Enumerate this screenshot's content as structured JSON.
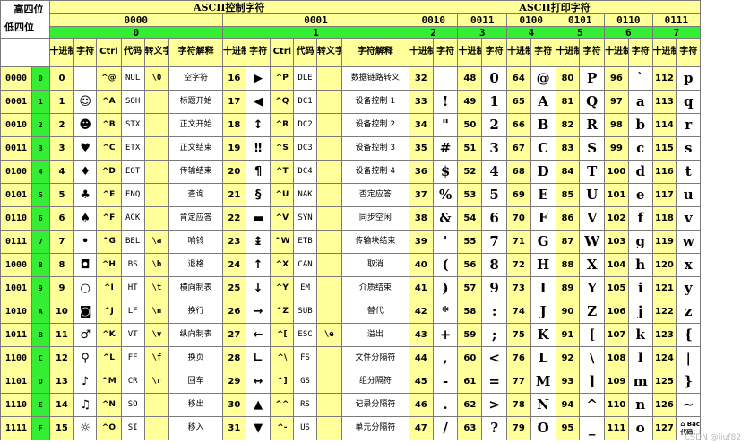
{
  "corner": {
    "top": "高四位",
    "bottom": "低四位"
  },
  "section_titles": {
    "control": "ASCII控制字符",
    "print": "ASCII打印字符"
  },
  "high_bits": {
    "c0": "0000",
    "c1": "0001",
    "p": [
      "0010",
      "0011",
      "0100",
      "0101",
      "0110",
      "0111"
    ]
  },
  "high_hex": {
    "c0": "0",
    "c1": "1",
    "p": [
      "2",
      "3",
      "4",
      "5",
      "6",
      "7"
    ]
  },
  "col_headers": {
    "dec": "十进制",
    "char": "字符",
    "ctrl": "Ctrl",
    "code": "代码",
    "esc": "转义字符",
    "explain": "字符解释"
  },
  "rows": [
    {
      "bits": "0000",
      "hex": "0",
      "c0": {
        "dec": "0",
        "char": "",
        "ctrl": "^@",
        "code": "NUL",
        "esc": "\\0",
        "exp": "空字符"
      },
      "c1": {
        "dec": "16",
        "char": "▶",
        "ctrl": "^P",
        "code": "DLE",
        "esc": "",
        "exp": "数据链路转义"
      },
      "p": [
        {
          "dec": "32",
          "ch": ""
        },
        {
          "dec": "48",
          "ch": "0"
        },
        {
          "dec": "64",
          "ch": "@"
        },
        {
          "dec": "80",
          "ch": "P"
        },
        {
          "dec": "96",
          "ch": "`"
        },
        {
          "dec": "112",
          "ch": "p"
        }
      ]
    },
    {
      "bits": "0001",
      "hex": "1",
      "c0": {
        "dec": "1",
        "char": "☺",
        "ctrl": "^A",
        "code": "SOH",
        "esc": "",
        "exp": "标题开始"
      },
      "c1": {
        "dec": "17",
        "char": "◀",
        "ctrl": "^Q",
        "code": "DC1",
        "esc": "",
        "exp": "设备控制 1"
      },
      "p": [
        {
          "dec": "33",
          "ch": "!"
        },
        {
          "dec": "49",
          "ch": "1"
        },
        {
          "dec": "65",
          "ch": "A"
        },
        {
          "dec": "81",
          "ch": "Q"
        },
        {
          "dec": "97",
          "ch": "a"
        },
        {
          "dec": "113",
          "ch": "q"
        }
      ]
    },
    {
      "bits": "0010",
      "hex": "2",
      "c0": {
        "dec": "2",
        "char": "☻",
        "ctrl": "^B",
        "code": "STX",
        "esc": "",
        "exp": "正文开始"
      },
      "c1": {
        "dec": "18",
        "char": "↕",
        "ctrl": "^R",
        "code": "DC2",
        "esc": "",
        "exp": "设备控制 2"
      },
      "p": [
        {
          "dec": "34",
          "ch": "\""
        },
        {
          "dec": "50",
          "ch": "2"
        },
        {
          "dec": "66",
          "ch": "B"
        },
        {
          "dec": "82",
          "ch": "R"
        },
        {
          "dec": "98",
          "ch": "b"
        },
        {
          "dec": "114",
          "ch": "r"
        }
      ]
    },
    {
      "bits": "0011",
      "hex": "3",
      "c0": {
        "dec": "3",
        "char": "♥",
        "ctrl": "^C",
        "code": "ETX",
        "esc": "",
        "exp": "正文结束"
      },
      "c1": {
        "dec": "19",
        "char": "‼",
        "ctrl": "^S",
        "code": "DC3",
        "esc": "",
        "exp": "设备控制 3"
      },
      "p": [
        {
          "dec": "35",
          "ch": "#"
        },
        {
          "dec": "51",
          "ch": "3"
        },
        {
          "dec": "67",
          "ch": "C"
        },
        {
          "dec": "83",
          "ch": "S"
        },
        {
          "dec": "99",
          "ch": "c"
        },
        {
          "dec": "115",
          "ch": "s"
        }
      ]
    },
    {
      "bits": "0100",
      "hex": "4",
      "c0": {
        "dec": "4",
        "char": "♦",
        "ctrl": "^D",
        "code": "EOT",
        "esc": "",
        "exp": "传输结束"
      },
      "c1": {
        "dec": "20",
        "char": "¶",
        "ctrl": "^T",
        "code": "DC4",
        "esc": "",
        "exp": "设备控制 4"
      },
      "p": [
        {
          "dec": "36",
          "ch": "$"
        },
        {
          "dec": "52",
          "ch": "4"
        },
        {
          "dec": "68",
          "ch": "D"
        },
        {
          "dec": "84",
          "ch": "T"
        },
        {
          "dec": "100",
          "ch": "d"
        },
        {
          "dec": "116",
          "ch": "t"
        }
      ]
    },
    {
      "bits": "0101",
      "hex": "5",
      "c0": {
        "dec": "5",
        "char": "♣",
        "ctrl": "^E",
        "code": "ENQ",
        "esc": "",
        "exp": "查询"
      },
      "c1": {
        "dec": "21",
        "char": "§",
        "ctrl": "^U",
        "code": "NAK",
        "esc": "",
        "exp": "否定应答"
      },
      "p": [
        {
          "dec": "37",
          "ch": "%"
        },
        {
          "dec": "53",
          "ch": "5"
        },
        {
          "dec": "69",
          "ch": "E"
        },
        {
          "dec": "85",
          "ch": "U"
        },
        {
          "dec": "101",
          "ch": "e"
        },
        {
          "dec": "117",
          "ch": "u"
        }
      ]
    },
    {
      "bits": "0110",
      "hex": "6",
      "c0": {
        "dec": "6",
        "char": "♠",
        "ctrl": "^F",
        "code": "ACK",
        "esc": "",
        "exp": "肯定应答"
      },
      "c1": {
        "dec": "22",
        "char": "▬",
        "ctrl": "^V",
        "code": "SYN",
        "esc": "",
        "exp": "同步空闲"
      },
      "p": [
        {
          "dec": "38",
          "ch": "&"
        },
        {
          "dec": "54",
          "ch": "6"
        },
        {
          "dec": "70",
          "ch": "F"
        },
        {
          "dec": "86",
          "ch": "V"
        },
        {
          "dec": "102",
          "ch": "f"
        },
        {
          "dec": "118",
          "ch": "v"
        }
      ]
    },
    {
      "bits": "0111",
      "hex": "7",
      "c0": {
        "dec": "7",
        "char": "•",
        "ctrl": "^G",
        "code": "BEL",
        "esc": "\\a",
        "exp": "响铃"
      },
      "c1": {
        "dec": "23",
        "char": "↨",
        "ctrl": "^W",
        "code": "ETB",
        "esc": "",
        "exp": "传输块结束"
      },
      "p": [
        {
          "dec": "39",
          "ch": "'"
        },
        {
          "dec": "55",
          "ch": "7"
        },
        {
          "dec": "71",
          "ch": "G"
        },
        {
          "dec": "87",
          "ch": "W"
        },
        {
          "dec": "103",
          "ch": "g"
        },
        {
          "dec": "119",
          "ch": "w"
        }
      ]
    },
    {
      "bits": "1000",
      "hex": "8",
      "c0": {
        "dec": "8",
        "char": "◘",
        "ctrl": "^H",
        "code": "BS",
        "esc": "\\b",
        "exp": "退格"
      },
      "c1": {
        "dec": "24",
        "char": "↑",
        "ctrl": "^X",
        "code": "CAN",
        "esc": "",
        "exp": "取消"
      },
      "p": [
        {
          "dec": "40",
          "ch": "("
        },
        {
          "dec": "56",
          "ch": "8"
        },
        {
          "dec": "72",
          "ch": "H"
        },
        {
          "dec": "88",
          "ch": "X"
        },
        {
          "dec": "104",
          "ch": "h"
        },
        {
          "dec": "120",
          "ch": "x"
        }
      ]
    },
    {
      "bits": "1001",
      "hex": "9",
      "c0": {
        "dec": "9",
        "char": "○",
        "ctrl": "^I",
        "code": "HT",
        "esc": "\\t",
        "exp": "横向制表"
      },
      "c1": {
        "dec": "25",
        "char": "↓",
        "ctrl": "^Y",
        "code": "EM",
        "esc": "",
        "exp": "介质结束"
      },
      "p": [
        {
          "dec": "41",
          "ch": ")"
        },
        {
          "dec": "57",
          "ch": "9"
        },
        {
          "dec": "73",
          "ch": "I"
        },
        {
          "dec": "89",
          "ch": "Y"
        },
        {
          "dec": "105",
          "ch": "i"
        },
        {
          "dec": "121",
          "ch": "y"
        }
      ]
    },
    {
      "bits": "1010",
      "hex": "A",
      "c0": {
        "dec": "10",
        "char": "◙",
        "ctrl": "^J",
        "code": "LF",
        "esc": "\\n",
        "exp": "换行"
      },
      "c1": {
        "dec": "26",
        "char": "→",
        "ctrl": "^Z",
        "code": "SUB",
        "esc": "",
        "exp": "替代"
      },
      "p": [
        {
          "dec": "42",
          "ch": "*"
        },
        {
          "dec": "58",
          "ch": ":"
        },
        {
          "dec": "74",
          "ch": "J"
        },
        {
          "dec": "90",
          "ch": "Z"
        },
        {
          "dec": "106",
          "ch": "j"
        },
        {
          "dec": "122",
          "ch": "z"
        }
      ]
    },
    {
      "bits": "1011",
      "hex": "B",
      "c0": {
        "dec": "11",
        "char": "♂",
        "ctrl": "^K",
        "code": "VT",
        "esc": "\\v",
        "exp": "纵向制表"
      },
      "c1": {
        "dec": "27",
        "char": "←",
        "ctrl": "^[",
        "code": "ESC",
        "esc": "\\e",
        "exp": "溢出"
      },
      "p": [
        {
          "dec": "43",
          "ch": "+"
        },
        {
          "dec": "59",
          "ch": ";"
        },
        {
          "dec": "75",
          "ch": "K"
        },
        {
          "dec": "91",
          "ch": "["
        },
        {
          "dec": "107",
          "ch": "k"
        },
        {
          "dec": "123",
          "ch": "{"
        }
      ]
    },
    {
      "bits": "1100",
      "hex": "C",
      "c0": {
        "dec": "12",
        "char": "♀",
        "ctrl": "^L",
        "code": "FF",
        "esc": "\\f",
        "exp": "换页"
      },
      "c1": {
        "dec": "28",
        "char": "∟",
        "ctrl": "^\\",
        "code": "FS",
        "esc": "",
        "exp": "文件分隔符"
      },
      "p": [
        {
          "dec": "44",
          "ch": ","
        },
        {
          "dec": "60",
          "ch": "<"
        },
        {
          "dec": "76",
          "ch": "L"
        },
        {
          "dec": "92",
          "ch": "\\"
        },
        {
          "dec": "108",
          "ch": "l"
        },
        {
          "dec": "124",
          "ch": "|"
        }
      ]
    },
    {
      "bits": "1101",
      "hex": "D",
      "c0": {
        "dec": "13",
        "char": "♪",
        "ctrl": "^M",
        "code": "CR",
        "esc": "\\r",
        "exp": "回车"
      },
      "c1": {
        "dec": "29",
        "char": "↔",
        "ctrl": "^]",
        "code": "GS",
        "esc": "",
        "exp": "组分隔符"
      },
      "p": [
        {
          "dec": "45",
          "ch": "-"
        },
        {
          "dec": "61",
          "ch": "="
        },
        {
          "dec": "77",
          "ch": "M"
        },
        {
          "dec": "93",
          "ch": "]"
        },
        {
          "dec": "109",
          "ch": "m"
        },
        {
          "dec": "125",
          "ch": "}"
        }
      ]
    },
    {
      "bits": "1110",
      "hex": "E",
      "c0": {
        "dec": "14",
        "char": "♫",
        "ctrl": "^N",
        "code": "SO",
        "esc": "",
        "exp": "移出"
      },
      "c1": {
        "dec": "30",
        "char": "▲",
        "ctrl": "^^",
        "code": "RS",
        "esc": "",
        "exp": "记录分隔符"
      },
      "p": [
        {
          "dec": "46",
          "ch": "."
        },
        {
          "dec": "62",
          "ch": ">"
        },
        {
          "dec": "78",
          "ch": "N"
        },
        {
          "dec": "94",
          "ch": "^"
        },
        {
          "dec": "110",
          "ch": "n"
        },
        {
          "dec": "126",
          "ch": "~"
        }
      ]
    },
    {
      "bits": "1111",
      "hex": "F",
      "c0": {
        "dec": "15",
        "char": "☼",
        "ctrl": "^O",
        "code": "SI",
        "esc": "",
        "exp": "移入"
      },
      "c1": {
        "dec": "31",
        "char": "▼",
        "ctrl": "^-",
        "code": "US",
        "esc": "",
        "exp": "单元分隔符"
      },
      "p": [
        {
          "dec": "47",
          "ch": "/"
        },
        {
          "dec": "63",
          "ch": "?"
        },
        {
          "dec": "79",
          "ch": "O"
        },
        {
          "dec": "95",
          "ch": "_"
        },
        {
          "dec": "111",
          "ch": "o"
        },
        {
          "dec": "127",
          "ch": ""
        }
      ]
    }
  ],
  "last_cell": {
    "line1": "⌂ Backspace",
    "line2": "代码：DEL"
  },
  "watermark": "CSDN @liuf82"
}
